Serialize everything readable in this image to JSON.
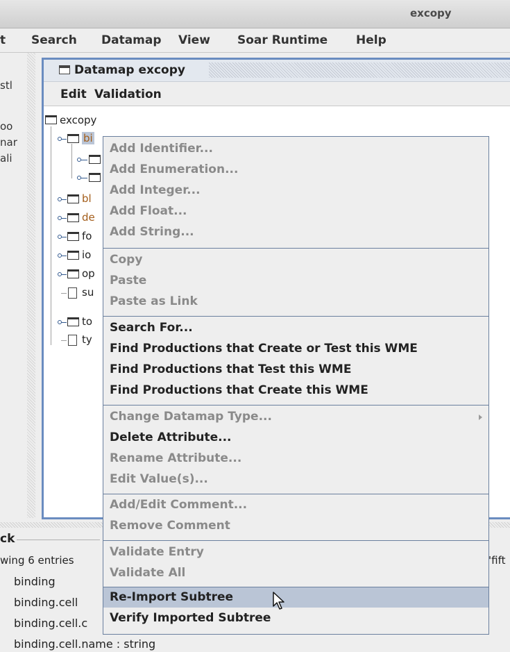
{
  "window": {
    "title": "excopy"
  },
  "menubar": {
    "items": [
      {
        "label": "t"
      },
      {
        "label": "Search"
      },
      {
        "label": "Datamap"
      },
      {
        "label": "View"
      },
      {
        "label": "Soar Runtime"
      },
      {
        "label": "Help"
      }
    ]
  },
  "left_panel": {
    "lines": [
      "stl",
      "oo",
      "nar",
      "ali"
    ]
  },
  "datamap": {
    "title": "Datamap excopy",
    "menu": [
      "Edit",
      "Validation"
    ],
    "tree": {
      "root": "excopy",
      "nodes": [
        {
          "label": "bi"
        },
        {
          "label": ""
        },
        {
          "label": ""
        },
        {
          "label": "bl"
        },
        {
          "label": "de"
        },
        {
          "label": "fo"
        },
        {
          "label": "io"
        },
        {
          "label": "op"
        },
        {
          "label": "su"
        },
        {
          "label": "to"
        },
        {
          "label": "ty"
        }
      ]
    }
  },
  "context_menu": {
    "groups": [
      [
        {
          "label": "Add Identifier...",
          "enabled": false
        },
        {
          "label": "Add Enumeration...",
          "enabled": false
        },
        {
          "label": "Add Integer...",
          "enabled": false
        },
        {
          "label": "Add Float...",
          "enabled": false
        },
        {
          "label": "Add String...",
          "enabled": false
        }
      ],
      [
        {
          "label": "Copy",
          "enabled": false
        },
        {
          "label": "Paste",
          "enabled": false
        },
        {
          "label": "Paste as Link",
          "enabled": false
        }
      ],
      [
        {
          "label": "Search For...",
          "enabled": true
        },
        {
          "label": "Find Productions that Create or Test this WME",
          "enabled": true
        },
        {
          "label": "Find Productions that Test this WME",
          "enabled": true
        },
        {
          "label": "Find Productions that Create this WME",
          "enabled": true
        }
      ],
      [
        {
          "label": "Change Datamap Type...",
          "enabled": false,
          "submenu": true
        },
        {
          "label": "Delete Attribute...",
          "enabled": true
        },
        {
          "label": "Rename Attribute...",
          "enabled": false
        },
        {
          "label": "Edit Value(s)...",
          "enabled": false
        }
      ],
      [
        {
          "label": "Add/Edit Comment...",
          "enabled": false
        },
        {
          "label": "Remove Comment",
          "enabled": false
        }
      ],
      [
        {
          "label": "Validate Entry",
          "enabled": false
        },
        {
          "label": "Validate All",
          "enabled": false
        }
      ],
      [
        {
          "label": "Re-Import Subtree",
          "enabled": true,
          "highlighted": true
        },
        {
          "label": "Verify Imported Subtree",
          "enabled": true
        }
      ]
    ]
  },
  "bottom_panel": {
    "title": "ck",
    "status": "wing 6 entries",
    "right_text": "'fift",
    "lines": [
      "binding",
      "binding.cell",
      "binding.cell.c",
      "binding.cell.name : string"
    ]
  }
}
